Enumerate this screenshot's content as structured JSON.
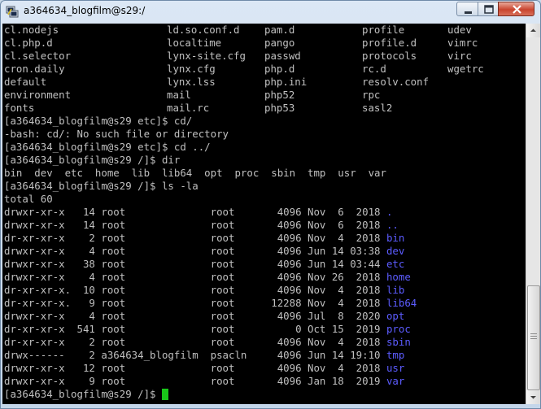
{
  "window": {
    "title": "a364634_blogfilm@s29:/"
  },
  "ls_grid": {
    "rows": [
      [
        "cl.nodejs",
        "ld.so.conf.d",
        "pam.d",
        "profile",
        "udev"
      ],
      [
        "cl.php.d",
        "localtime",
        "pango",
        "profile.d",
        "vimrc"
      ],
      [
        "cl.selector",
        "lynx-site.cfg",
        "passwd",
        "protocols",
        "virc"
      ],
      [
        "cron.daily",
        "lynx.cfg",
        "php.d",
        "rc.d",
        "wgetrc"
      ],
      [
        "default",
        "lynx.lss",
        "php.ini",
        "resolv.conf",
        ""
      ],
      [
        "environment",
        "mail",
        "php52",
        "rpc",
        ""
      ],
      [
        "fonts",
        "mail.rc",
        "php53",
        "sasl2",
        ""
      ]
    ]
  },
  "session": {
    "l1": "[a364634_blogfilm@s29 etc]$ cd/",
    "l2": "-bash: cd/: No such file or directory",
    "l3": "[a364634_blogfilm@s29 etc]$ cd ../",
    "l4": "[a364634_blogfilm@s29 /]$ dir",
    "l5": "bin  dev  etc  home  lib  lib64  opt  proc  sbin  tmp  usr  var",
    "l6": "[a364634_blogfilm@s29 /]$ ls -la",
    "l7": "total 60"
  },
  "listing": [
    {
      "perm": "drwxr-xr-x ",
      "links": " 14",
      "owner": "root             ",
      "group": "root  ",
      "size": " 4096",
      "date": "Nov  6  2018",
      "name": "."
    },
    {
      "perm": "drwxr-xr-x ",
      "links": " 14",
      "owner": "root             ",
      "group": "root  ",
      "size": " 4096",
      "date": "Nov  6  2018",
      "name": ".."
    },
    {
      "perm": "dr-xr-xr-x ",
      "links": "  2",
      "owner": "root             ",
      "group": "root  ",
      "size": " 4096",
      "date": "Nov  4  2018",
      "name": "bin"
    },
    {
      "perm": "drwxr-xr-x ",
      "links": "  4",
      "owner": "root             ",
      "group": "root  ",
      "size": " 4096",
      "date": "Jun 14 03:38",
      "name": "dev"
    },
    {
      "perm": "drwxr-xr-x ",
      "links": " 38",
      "owner": "root             ",
      "group": "root  ",
      "size": " 4096",
      "date": "Jun 14 03:44",
      "name": "etc"
    },
    {
      "perm": "drwxr-xr-x ",
      "links": "  4",
      "owner": "root             ",
      "group": "root  ",
      "size": " 4096",
      "date": "Nov 26  2018",
      "name": "home"
    },
    {
      "perm": "dr-xr-xr-x.",
      "links": " 10",
      "owner": "root             ",
      "group": "root  ",
      "size": " 4096",
      "date": "Nov  4  2018",
      "name": "lib"
    },
    {
      "perm": "dr-xr-xr-x.",
      "links": "  9",
      "owner": "root             ",
      "group": "root  ",
      "size": "12288",
      "date": "Nov  4  2018",
      "name": "lib64"
    },
    {
      "perm": "drwxr-xr-x ",
      "links": "  4",
      "owner": "root             ",
      "group": "root  ",
      "size": " 4096",
      "date": "Jul  8  2020",
      "name": "opt"
    },
    {
      "perm": "dr-xr-xr-x ",
      "links": "541",
      "owner": "root             ",
      "group": "root  ",
      "size": "    0",
      "date": "Oct 15  2019",
      "name": "proc"
    },
    {
      "perm": "dr-xr-xr-x ",
      "links": "  2",
      "owner": "root             ",
      "group": "root  ",
      "size": " 4096",
      "date": "Nov  4  2018",
      "name": "sbin"
    },
    {
      "perm": "drwx------ ",
      "links": "  2",
      "owner": "a364634_blogfilm ",
      "group": "psacln",
      "size": " 4096",
      "date": "Jun 14 19:10",
      "name": "tmp"
    },
    {
      "perm": "drwxr-xr-x ",
      "links": " 12",
      "owner": "root             ",
      "group": "root  ",
      "size": " 4096",
      "date": "Nov  4  2018",
      "name": "usr"
    },
    {
      "perm": "drwxr-xr-x ",
      "links": "  9",
      "owner": "root             ",
      "group": "root  ",
      "size": " 4096",
      "date": "Jan 18  2019",
      "name": "var"
    }
  ],
  "prompt": "[a364634_blogfilm@s29 /]$ ",
  "colors": {
    "terminal_bg": "#000000",
    "terminal_fg": "#c0c0c0",
    "directory": "#5c5cff",
    "cursor": "#19c819"
  },
  "icons": {
    "app": "putty-terminal-icon",
    "minimize": "minimize-icon",
    "maximize": "maximize-icon",
    "close": "close-icon"
  }
}
